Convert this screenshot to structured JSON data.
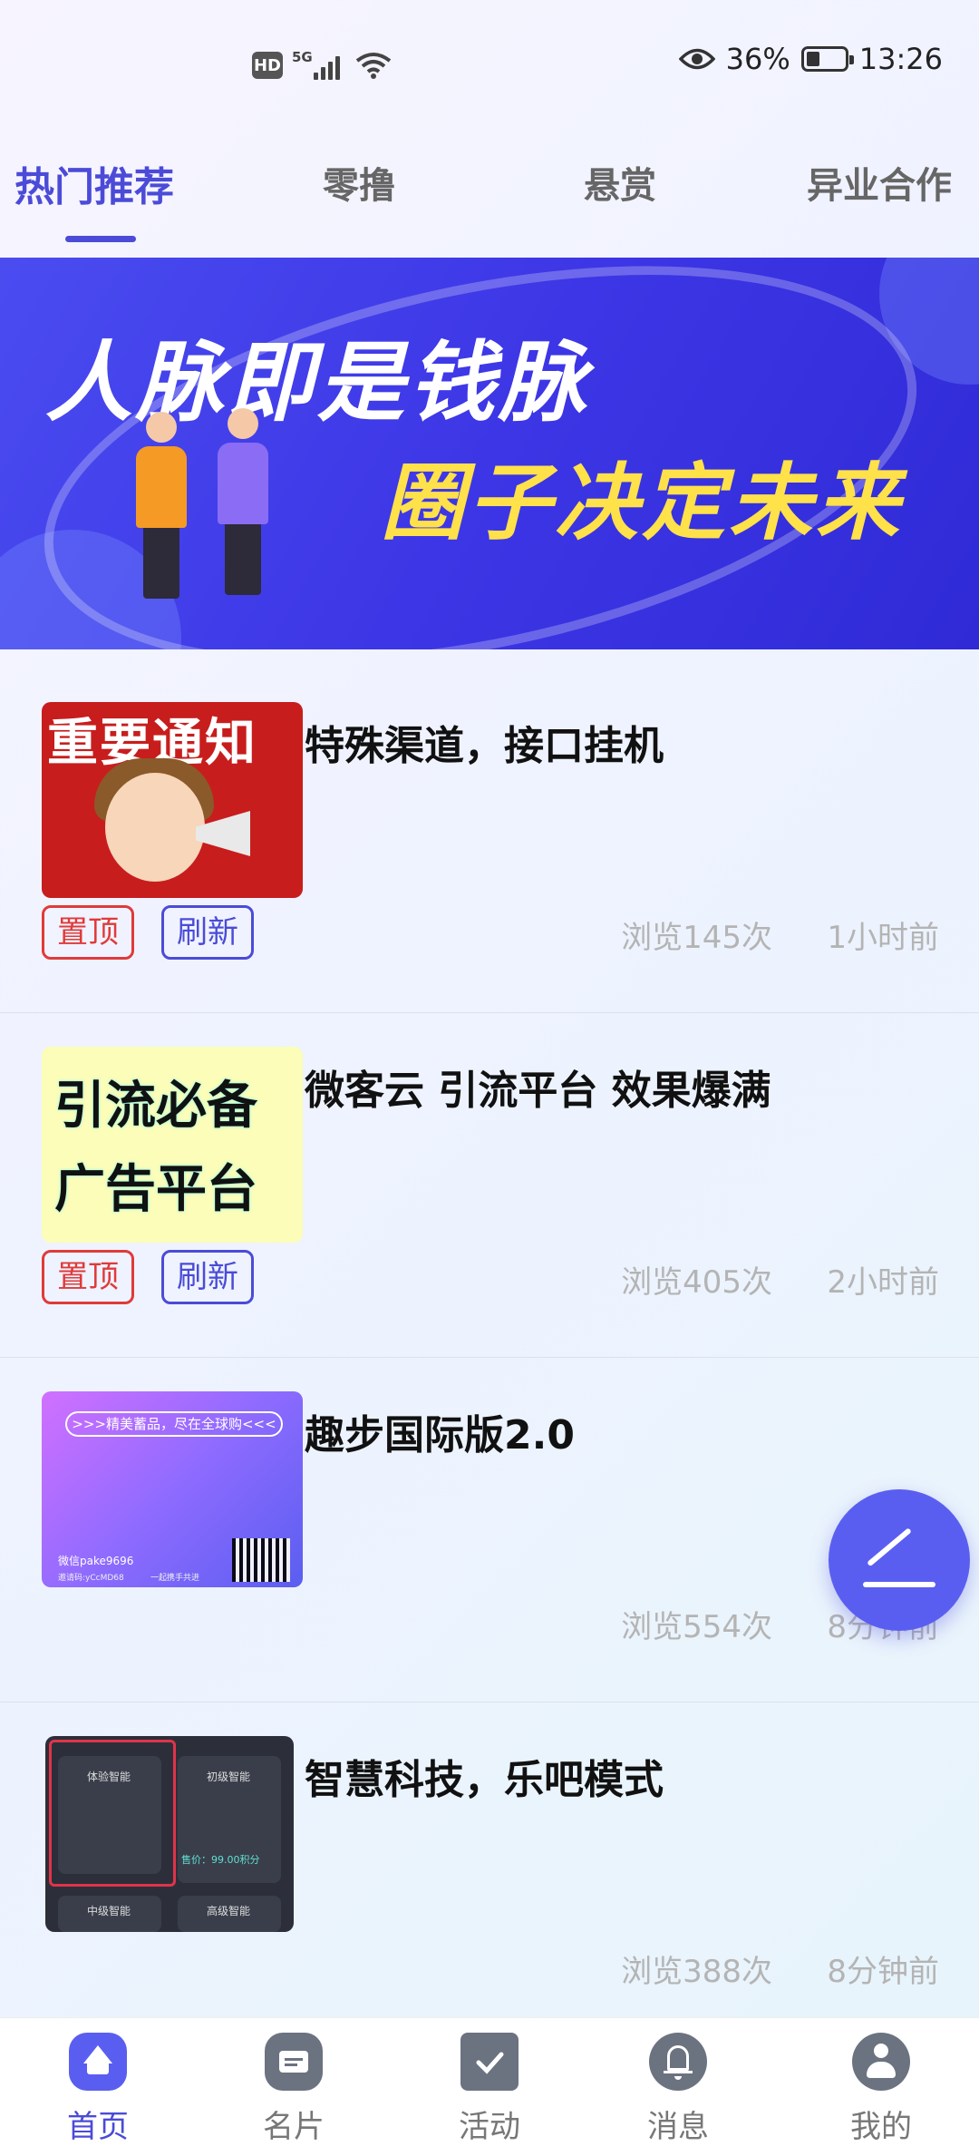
{
  "status_bar": {
    "network_badge": "HD",
    "signal_label": "5G",
    "battery": "36%",
    "battery_level": 0.36,
    "time": "13:26",
    "icons": [
      "hd-icon",
      "signal-icon",
      "wifi-icon",
      "eye-icon",
      "battery-icon"
    ]
  },
  "tabs": [
    {
      "label": "热门推荐",
      "active": true
    },
    {
      "label": "零撸",
      "active": false
    },
    {
      "label": "悬赏",
      "active": false
    },
    {
      "label": "异业合作",
      "active": false
    }
  ],
  "banner": {
    "line1": "人脉即是钱脉",
    "line2": "圈子决定未来"
  },
  "posts": [
    {
      "title": "特殊渠道，接口挂机",
      "thumb_text": "重要通知",
      "tags": [
        "置顶",
        "刷新"
      ],
      "views": "浏览145次",
      "time": "1小时前"
    },
    {
      "title": "微客云 引流平台 效果爆满",
      "thumb_text": [
        "引流必备",
        "广告平台"
      ],
      "tags": [
        "置顶",
        "刷新"
      ],
      "views": "浏览405次",
      "time": "2小时前"
    },
    {
      "title": "趣步国际版2.0",
      "thumb_text": ">>>精美蓄品，尽在全球购<<<",
      "thumb_wechat": "微信pake9696",
      "thumb_code": "邀请码:yCcMD68",
      "thumb_slogan": "一起携手共进",
      "views": "浏览554次",
      "time": "8分钟前"
    },
    {
      "title": "智慧科技，乐吧模式",
      "thumb_labels": [
        "体验智能",
        "初级智能",
        "中级智能",
        "高级智能"
      ],
      "thumb_price": "售价：99.00积分",
      "views": "浏览388次",
      "time": "8分钟前"
    }
  ],
  "fab": {
    "icon": "edit-icon"
  },
  "bottom_nav": [
    {
      "label": "首页",
      "icon": "home-icon",
      "active": true
    },
    {
      "label": "名片",
      "icon": "card-icon",
      "active": false
    },
    {
      "label": "活动",
      "icon": "activity-icon",
      "active": false
    },
    {
      "label": "消息",
      "icon": "bell-icon",
      "active": false
    },
    {
      "label": "我的",
      "icon": "user-icon",
      "active": false
    }
  ],
  "colors": {
    "accent": "#4b4bd8",
    "pin": "#e03a3a",
    "fab": "#5a5ef0"
  }
}
